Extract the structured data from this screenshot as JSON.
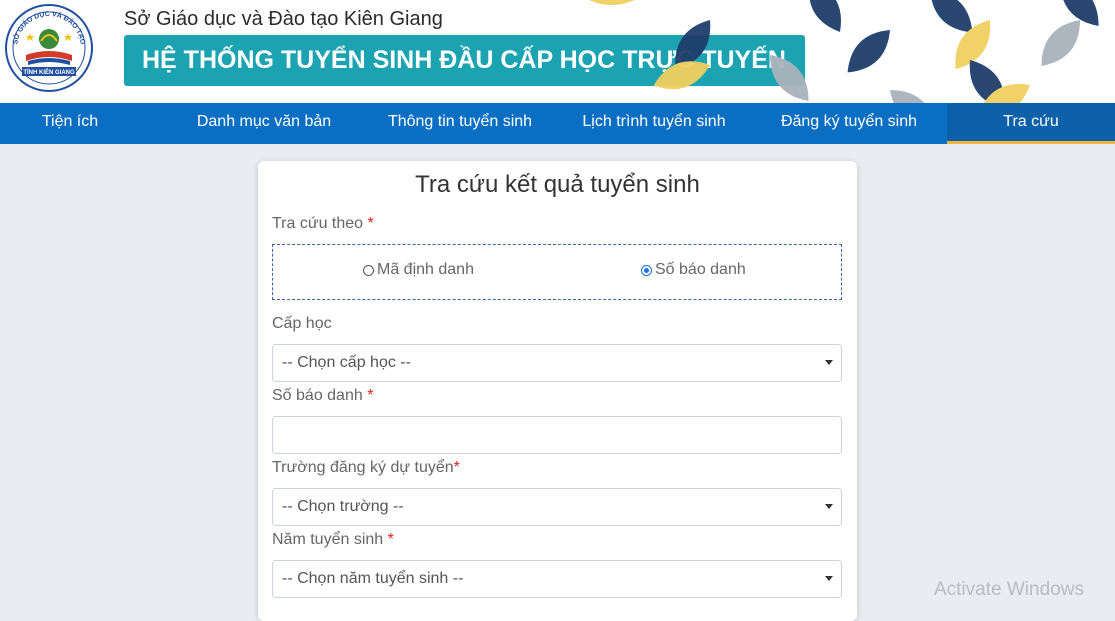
{
  "header": {
    "org_name": "Sở Giáo dục và Đào tạo Kiên Giang",
    "system_title": "HỆ THỐNG TUYỂN SINH ĐẦU CẤP HỌC TRỰC TUYẾN",
    "logo": {
      "top_text": "SỞ GIÁO DỤC VÀ ĐÀO TẠO",
      "bottom_text": "TỈNH KIÊN GIANG"
    }
  },
  "nav": {
    "items": [
      {
        "label": "Tiện ích"
      },
      {
        "label": "Danh mục văn bản"
      },
      {
        "label": "Thông tin tuyển sinh"
      },
      {
        "label": "Lịch trình tuyển sinh"
      },
      {
        "label": "Đăng ký tuyển sinh"
      },
      {
        "label": "Tra cứu",
        "active": true
      }
    ],
    "accent_color": "#f0b43a"
  },
  "form": {
    "title": "Tra cứu kết quả tuyển sinh",
    "lookup_by_label": "Tra cứu theo",
    "required_mark": "*",
    "options": [
      {
        "label": "Mã định danh",
        "checked": false
      },
      {
        "label": "Số báo danh",
        "checked": true
      }
    ],
    "level_label": "Cấp học",
    "level_select": "-- Chọn cấp học --",
    "sbd_label": "Số báo danh",
    "sbd_value": "",
    "school_label": "Trường đăng ký dự tuyển",
    "school_select": "-- Chọn trường --",
    "year_label": "Năm tuyển sinh",
    "year_select": "-- Chọn năm tuyển sinh --"
  },
  "watermark": "Activate Windows",
  "colors": {
    "nav_bg": "#0a6fc2",
    "title_bg": "#1ba3b2",
    "page_bg": "#e9ecf1"
  }
}
